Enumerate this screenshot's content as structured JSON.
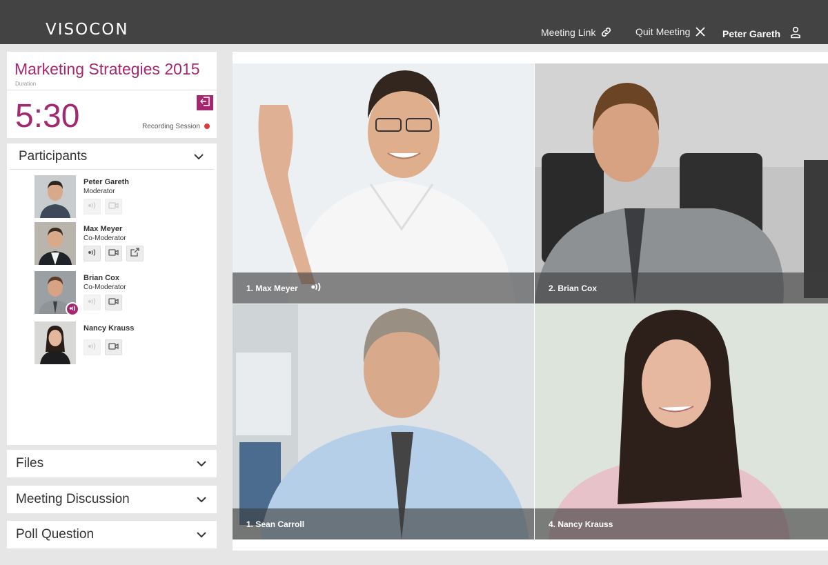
{
  "app": {
    "logo": "VISOCON"
  },
  "topbar": {
    "meeting_link": "Meeting Link",
    "quit_meeting": "Quit Meeting",
    "user_name": "Peter Gareth"
  },
  "meeting": {
    "title": "Marketing Strategies 2015",
    "duration_label": "Duration",
    "timer": "5:30",
    "recording_label": "Recording Session"
  },
  "participants": {
    "header": "Participants",
    "items": [
      {
        "name": "Peter Gareth",
        "role": "Moderator"
      },
      {
        "name": "Max Meyer",
        "role": "Co-Moderator"
      },
      {
        "name": "Brian Cox",
        "role": "Co-Moderator"
      },
      {
        "name": "Nancy Krauss",
        "role": ""
      }
    ]
  },
  "sections": {
    "files": "Files",
    "discussion": "Meeting Discussion",
    "poll": "Poll Question"
  },
  "videos": [
    {
      "caption": "1. Max Meyer"
    },
    {
      "caption": "2. Brian Cox"
    },
    {
      "caption": "1. Sean Carroll"
    },
    {
      "caption": "4. Nancy Krauss"
    }
  ],
  "colors": {
    "accent": "#a3286f",
    "topbar": "#434343",
    "recording": "#e03b3b"
  }
}
